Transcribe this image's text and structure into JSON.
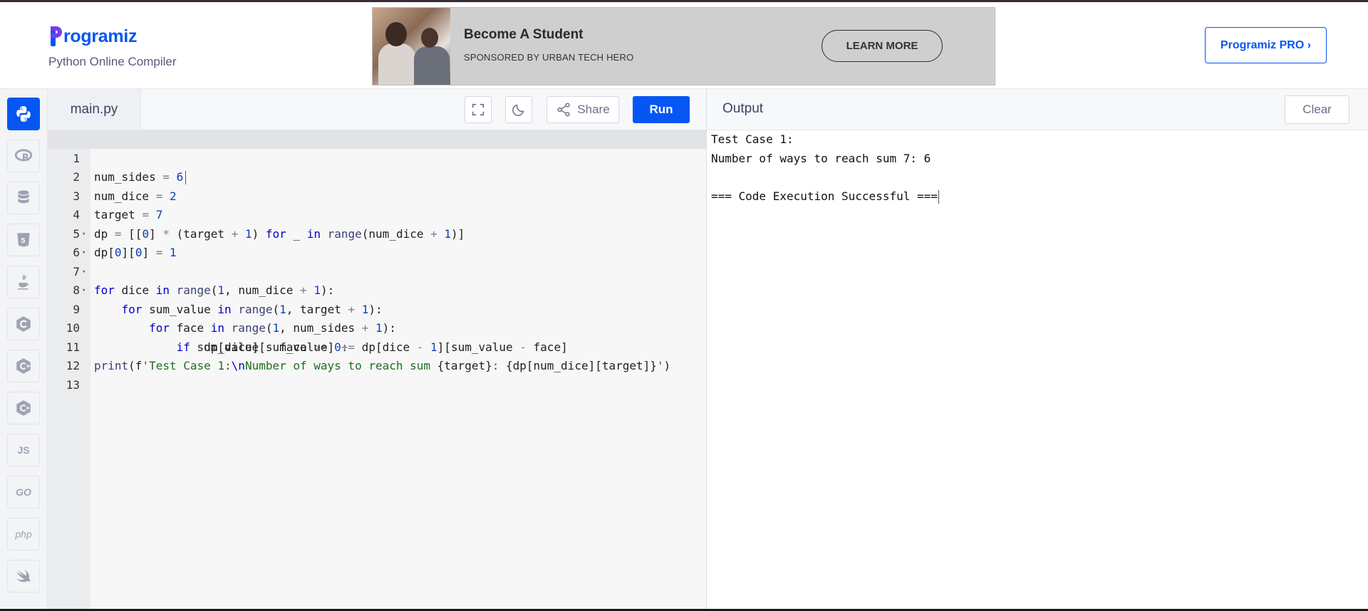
{
  "header": {
    "brand": "rogramiz",
    "subtitle": "Python Online Compiler",
    "pro_button": "Programiz PRO ›"
  },
  "ad": {
    "title": "Become A Student",
    "sponsor": "SPONSORED BY URBAN TECH HERO",
    "cta": "LEARN MORE"
  },
  "sidebar": {
    "languages": [
      "python",
      "r",
      "sql",
      "html",
      "java",
      "c",
      "cpp",
      "csharp",
      "js",
      "go",
      "php",
      "swift"
    ],
    "labels": {
      "js": "JS",
      "go": "GO",
      "php": "php"
    }
  },
  "editor": {
    "file_name": "main.py",
    "share_label": "Share",
    "run_label": "Run",
    "line_numbers": [
      "1",
      "2",
      "3",
      "4",
      "5",
      "6",
      "7",
      "8",
      "9",
      "10",
      "11",
      "12",
      "13"
    ],
    "lines": [
      "num_sides = 6",
      "num_dice = 2",
      "target = 7",
      "dp = [[0] * (target + 1) for _ in range(num_dice + 1)]",
      "dp[0][0] = 1",
      "for dice in range(1, num_dice + 1):",
      "    for sum_value in range(1, target + 1):",
      "        for face in range(1, num_sides + 1):",
      "            if sum_value - face >= 0:",
      "                dp[dice][sum_value] += dp[dice - 1][sum_value - face]",
      "print(f'Test Case 1:\\nNumber of ways to reach sum {target}: {dp[num_dice][target]}')",
      "",
      ""
    ]
  },
  "output": {
    "title": "Output",
    "clear_label": "Clear",
    "lines": [
      "Test Case 1:",
      "Number of ways to reach sum 7: 6",
      "",
      "=== Code Execution Successful ==="
    ]
  },
  "colors": {
    "accent": "#0556f3",
    "keyword": "#0000cc",
    "number": "#0b3fb5",
    "string": "#1f6e1f"
  }
}
